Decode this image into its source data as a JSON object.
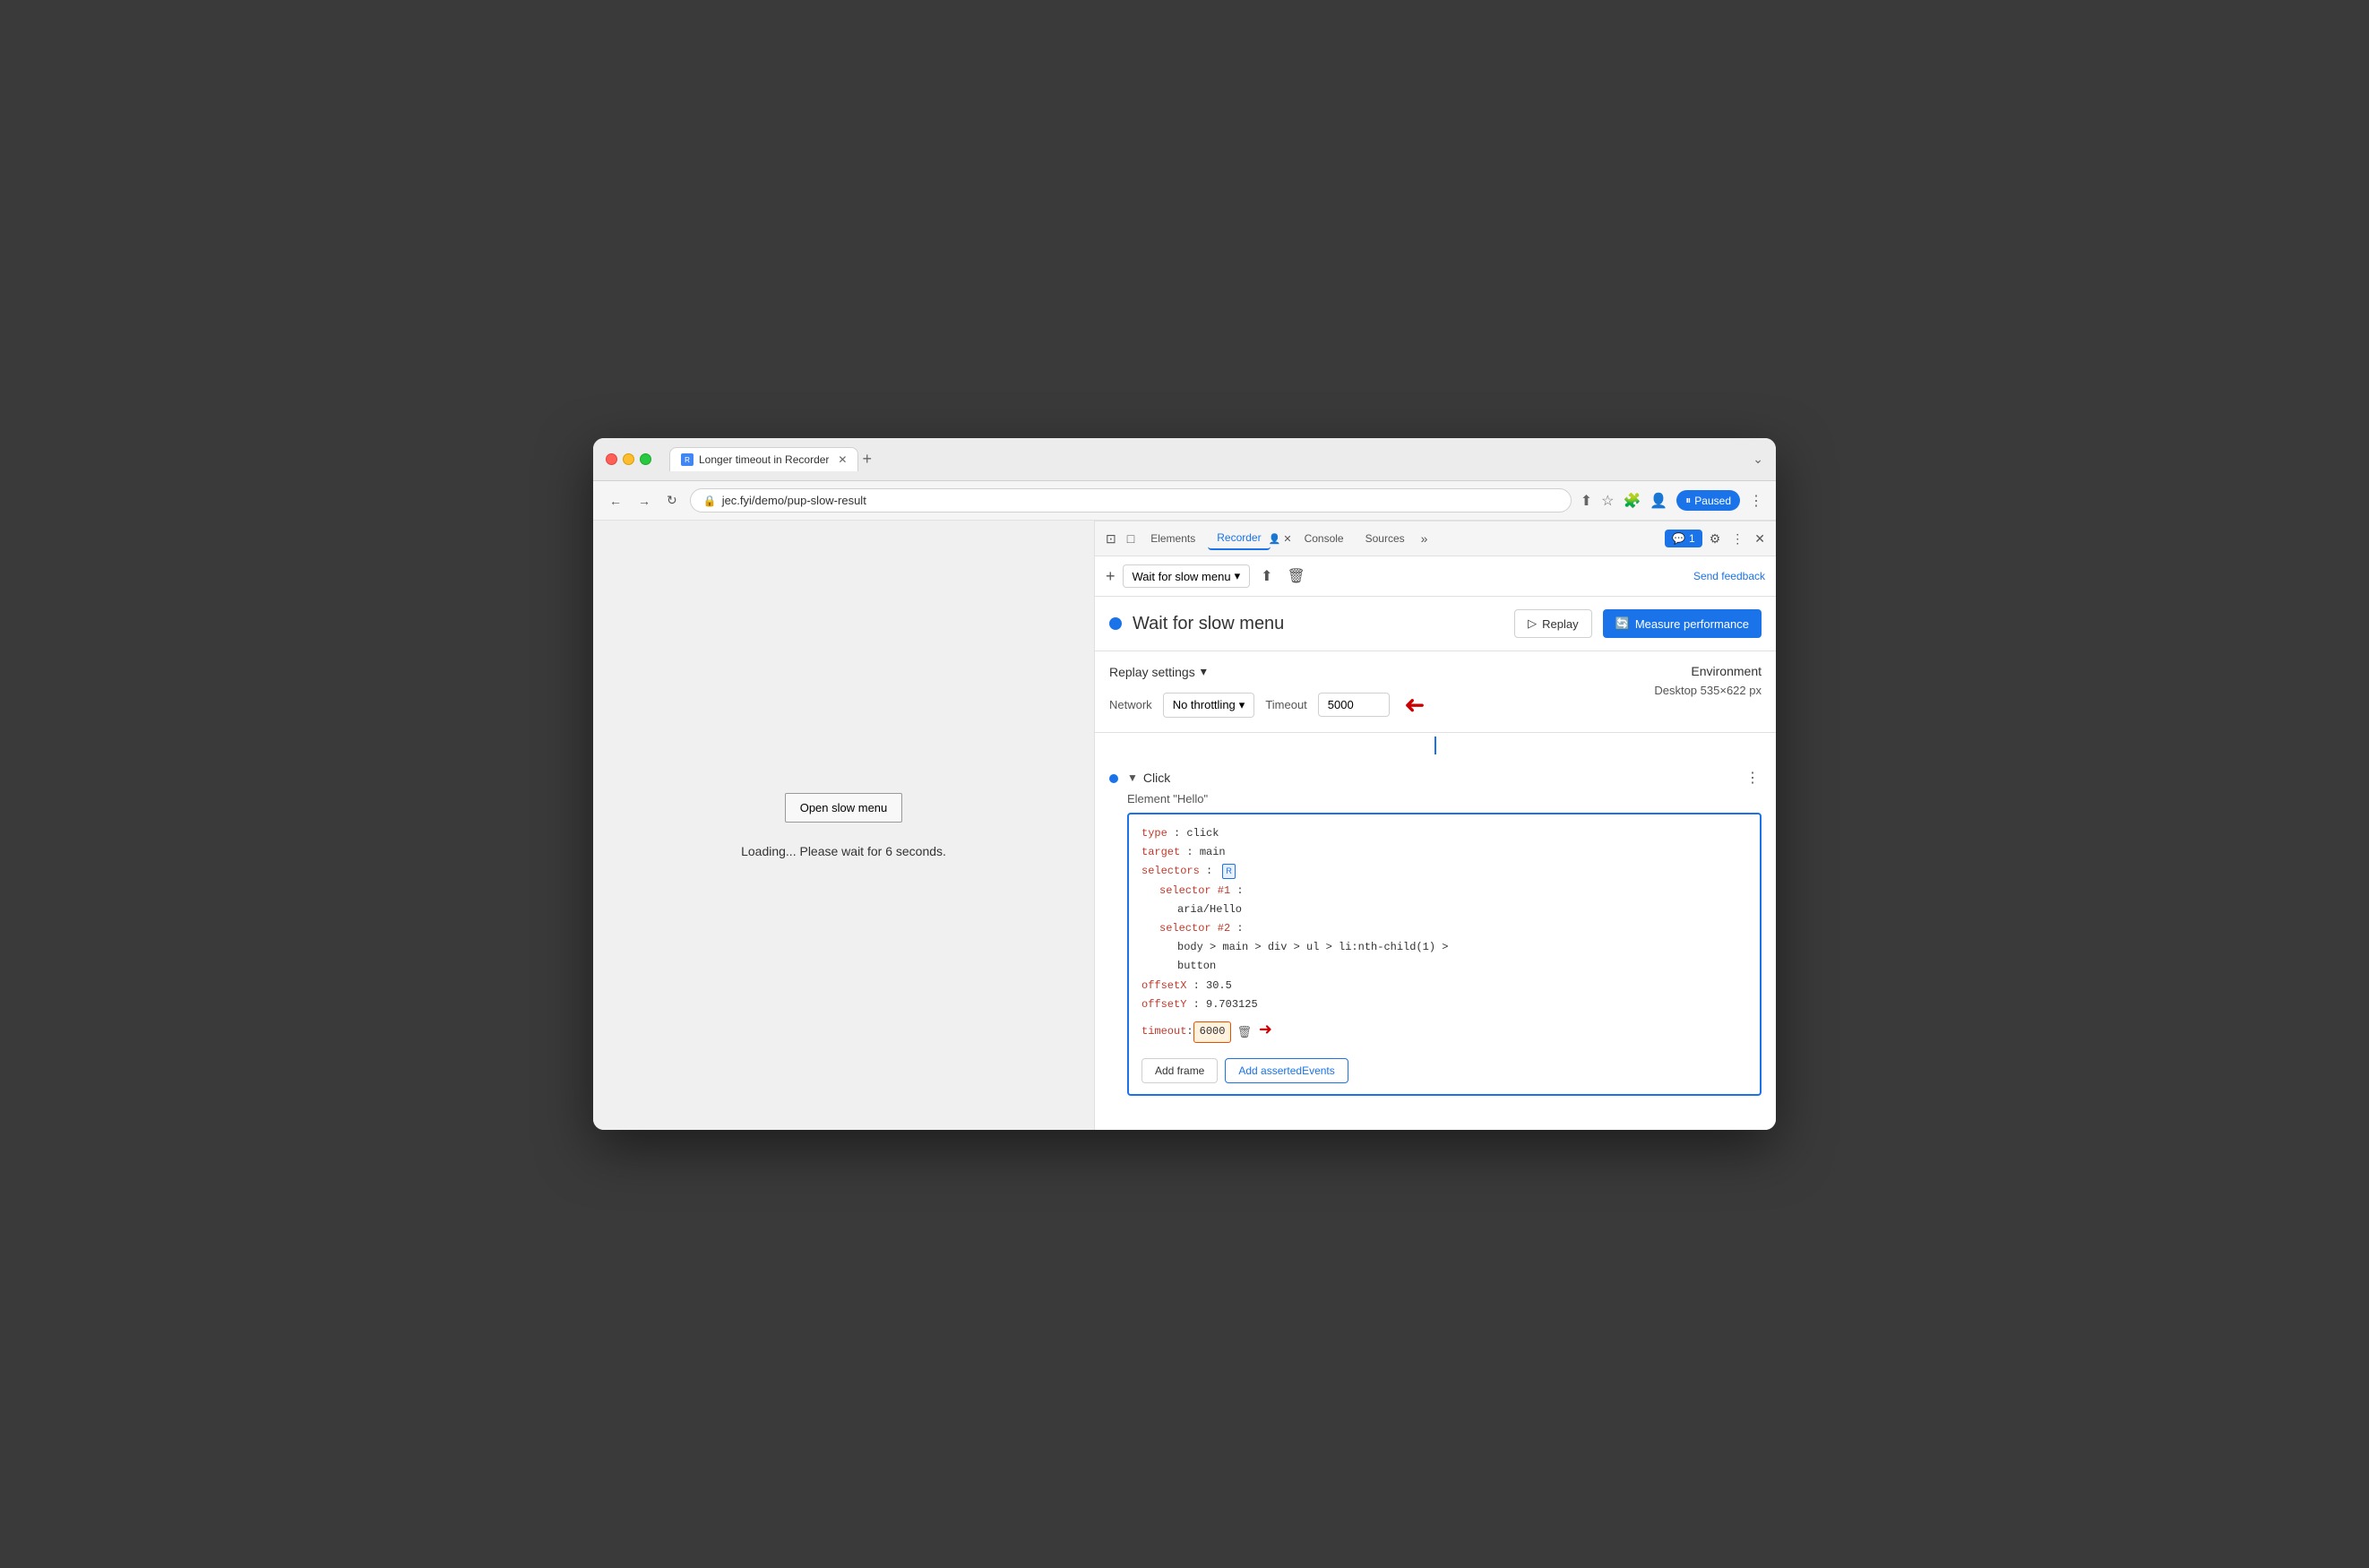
{
  "browser": {
    "tab_title": "Longer timeout in Recorder",
    "url": "jec.fyi/demo/pup-slow-result",
    "paused_label": "Paused"
  },
  "devtools": {
    "tabs": [
      "Elements",
      "Recorder",
      "Console",
      "Sources"
    ],
    "active_tab": "Recorder",
    "notification_count": "1"
  },
  "recorder": {
    "toolbar": {
      "recording_name": "Wait for slow menu",
      "send_feedback": "Send feedback",
      "add_button": "+",
      "export_button": "↑",
      "delete_button": "🗑"
    },
    "header": {
      "title": "Wait for slow menu",
      "replay_btn": "Replay",
      "measure_btn": "Measure performance"
    },
    "replay_settings": {
      "title": "Replay settings",
      "network_label": "Network",
      "throttling_value": "No throttling",
      "timeout_label": "Timeout",
      "timeout_value": "5000"
    },
    "environment": {
      "title": "Environment",
      "device": "Desktop",
      "resolution": "535×622 px"
    },
    "step": {
      "type": "Click",
      "description": "Element \"Hello\"",
      "expand_icon": "▼",
      "more_icon": "⋮"
    },
    "code": {
      "type_key": "type",
      "type_val": "click",
      "target_key": "target",
      "target_val": "main",
      "selectors_key": "selectors",
      "selector1_key": "selector #1",
      "selector1_val": "aria/Hello",
      "selector2_key": "selector #2",
      "selector2_val": "body > main > div > ul > li:nth-child(1) >",
      "selector2_val2": "button",
      "offsetX_key": "offsetX",
      "offsetX_val": "30.5",
      "offsetY_key": "offsetY",
      "offsetY_val": "9.703125",
      "timeout_key": "timeout",
      "timeout_val": "6000",
      "add_frame_btn": "Add frame",
      "add_asserted_btn": "Add assertedEvents"
    }
  },
  "page": {
    "open_menu_btn": "Open slow menu",
    "loading_text": "Loading... Please wait for 6 seconds."
  }
}
